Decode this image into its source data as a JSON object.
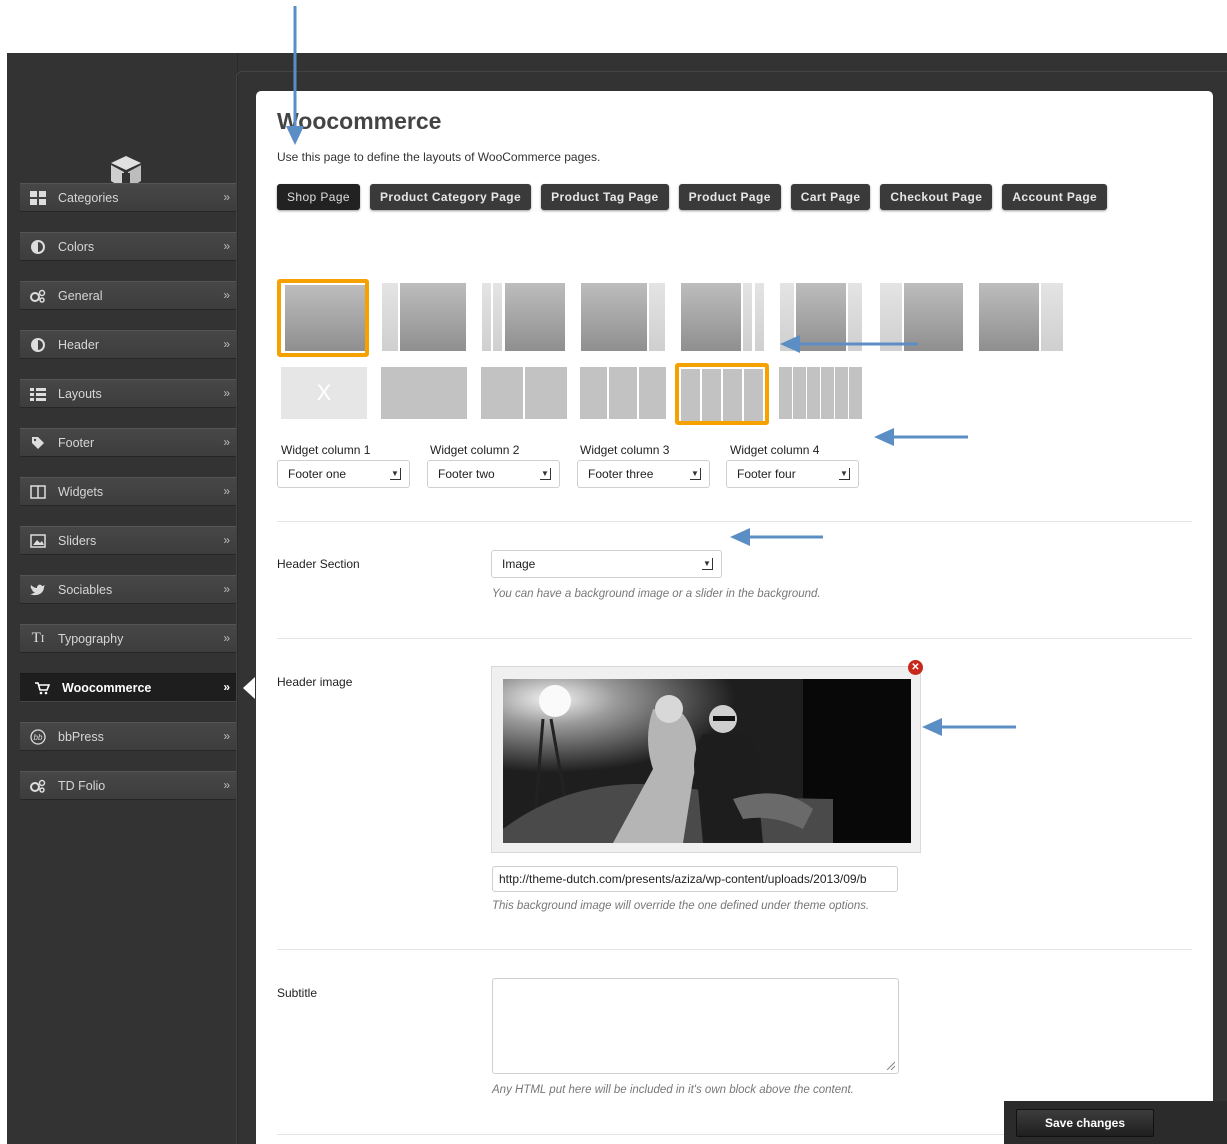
{
  "sidebar": {
    "logo_icon": "puzzle-tree-logo-icon",
    "items": [
      {
        "label": "Categories",
        "icon": "grid-icon"
      },
      {
        "label": "Colors",
        "icon": "half-circle-icon"
      },
      {
        "label": "General",
        "icon": "gears-icon"
      },
      {
        "label": "Header",
        "icon": "half-circle-icon"
      },
      {
        "label": "Layouts",
        "icon": "list-icon"
      },
      {
        "label": "Footer",
        "icon": "tag-icon"
      },
      {
        "label": "Widgets",
        "icon": "columns-icon"
      },
      {
        "label": "Sliders",
        "icon": "image-icon"
      },
      {
        "label": "Sociables",
        "icon": "twitter-bird-icon"
      },
      {
        "label": "Typography",
        "icon": "typography-icon"
      },
      {
        "label": "Woocommerce",
        "icon": "cart-icon"
      },
      {
        "label": "bbPress",
        "icon": "bbpress-icon"
      },
      {
        "label": "TD Folio",
        "icon": "gears-icon"
      }
    ],
    "active": "Woocommerce",
    "chevron": "»"
  },
  "page": {
    "title": "Woocommerce",
    "description": "Use this page to define the layouts of WooCommerce pages."
  },
  "tabs": [
    "Shop Page",
    "Product Category Page",
    "Product Tag Page",
    "Product Page",
    "Cart Page",
    "Checkout Page",
    "Account Page"
  ],
  "selected_tab": "Shop Page",
  "layout_options": {
    "selected_sidebar_layout": 1,
    "selected_footer_layout": 5,
    "footer_none_glyph": "X"
  },
  "widgets": [
    {
      "label": "Widget column 1",
      "value": "Footer one"
    },
    {
      "label": "Widget column 2",
      "value": "Footer two"
    },
    {
      "label": "Widget column 3",
      "value": "Footer three"
    },
    {
      "label": "Widget column 4",
      "value": "Footer four"
    }
  ],
  "header_section": {
    "label": "Header Section",
    "value": "Image",
    "help": "You can have a background image or a slider in the background."
  },
  "header_image": {
    "label": "Header image",
    "url": "http://theme-dutch.com/presents/aziza/wp-content/uploads/2013/09/b",
    "help": "This background image will override the one defined under theme options."
  },
  "subtitle": {
    "label": "Subtitle",
    "value": "",
    "help": "Any HTML put here will be included in it's own block above the content."
  },
  "save_label": "Save changes",
  "colors": {
    "accent_selected": "#f5a100",
    "annotation_arrow": "#5b8ec4",
    "remove_button": "#c8281c"
  }
}
